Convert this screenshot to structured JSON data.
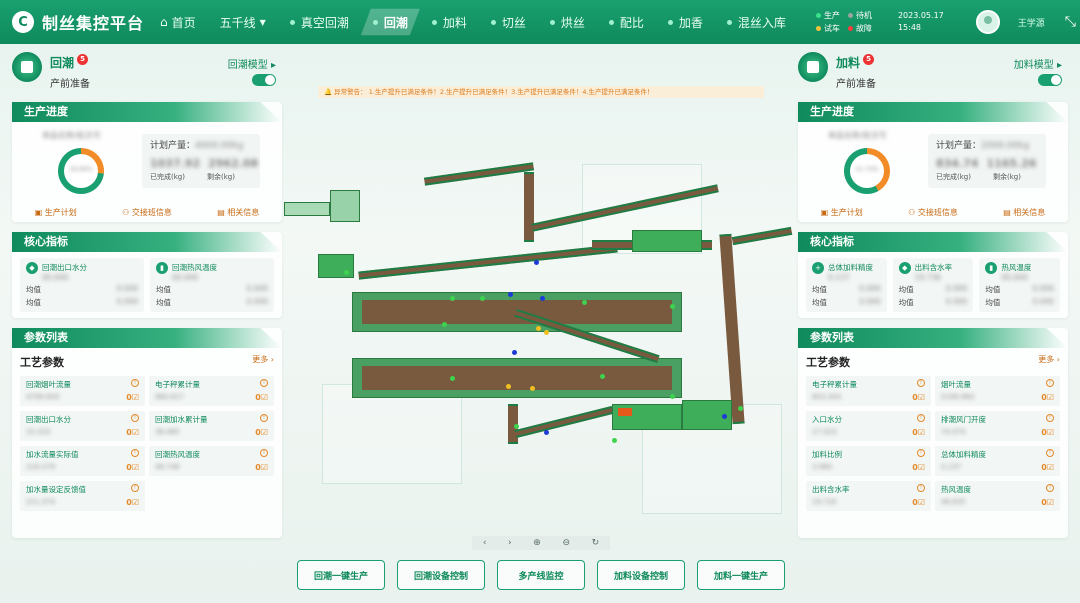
{
  "header": {
    "app_title": "制丝集控平台",
    "logo": "C",
    "nav": {
      "home": "首页",
      "line": "五千线",
      "tabs": [
        "真空回潮",
        "回潮",
        "加料",
        "切丝",
        "烘丝",
        "配比",
        "加香",
        "混丝入库"
      ],
      "active_tab": "回潮"
    },
    "legend": [
      {
        "label": "生产",
        "color": "#38e08a"
      },
      {
        "label": "待机",
        "color": "#9aa3a0"
      },
      {
        "label": "试车",
        "color": "#f6c23e"
      },
      {
        "label": "故障",
        "color": "#ff3b3b"
      }
    ],
    "date": "2023.05.17",
    "time": "15:48",
    "user": "王学源"
  },
  "left": {
    "process": {
      "name": "回潮",
      "badge": "5",
      "state": "产前准备",
      "model_link": "回潮模型 ▸"
    },
    "progress": {
      "title": "生产进度",
      "batch": "单品名称/批次号",
      "percent_text": "26.84%",
      "percent_value": 0.2684,
      "plan_label": "计划产量：",
      "plan_value": "4000.00kg",
      "done_value": "1037.92",
      "remain_value": "2962.08",
      "done_label": "已完成(kg)",
      "remain_label": "剩余(kg)",
      "links": [
        "生产计划",
        "交接班信息",
        "相关信息"
      ]
    },
    "kpi": {
      "title": "核心指标",
      "items": [
        {
          "name": "回潮出口水分",
          "value": "00.000"
        },
        {
          "name": "回潮热风温度",
          "value": "00.000"
        }
      ],
      "rows": [
        [
          "均值",
          "0.000",
          "0.000"
        ],
        [
          "均值",
          "0.000",
          "0.000"
        ]
      ]
    },
    "params": {
      "title": "参数列表",
      "sub_title": "工艺参数",
      "more": "更多 ›",
      "items": [
        {
          "label": "回潮烟叶流量",
          "value": "4799.600"
        },
        {
          "label": "电子秤累计量",
          "value": "960.617"
        },
        {
          "label": "回潮出口水分",
          "value": "15.253"
        },
        {
          "label": "回潮加水累计量",
          "value": "38.485"
        },
        {
          "label": "加水流量实际值",
          "value": "218.279"
        },
        {
          "label": "回潮热风温度",
          "value": "48.748"
        },
        {
          "label": "加水量设定反馈值",
          "value": "211.374"
        }
      ],
      "edit_mark": "0☑"
    }
  },
  "right": {
    "process": {
      "name": "加料",
      "badge": "5",
      "state": "产前准备",
      "model_link": "加料模型 ▸"
    },
    "progress": {
      "title": "生产进度",
      "batch": "单品名称/批次号",
      "percent_text": "41.74%",
      "percent_value": 0.4174,
      "plan_label": "计划产量：",
      "plan_value": "2000.00kg",
      "done_value": "834.74",
      "remain_value": "1165.26",
      "done_label": "已完成(kg)",
      "remain_label": "剩余(kg)",
      "links": [
        "生产计划",
        "交接班信息",
        "相关信息"
      ]
    },
    "kpi": {
      "title": "核心指标",
      "items": [
        {
          "name": "总体加料精度",
          "value": "0.137"
        },
        {
          "name": "出料含水率",
          "value": "19.736"
        },
        {
          "name": "热风温度",
          "value": "00.000"
        }
      ],
      "rows": [
        [
          "均值",
          "0.000",
          "0.000",
          "0.000"
        ],
        [
          "均值",
          "0.000",
          "0.000",
          "0.000"
        ]
      ]
    },
    "params": {
      "title": "参数列表",
      "sub_title": "工艺参数",
      "more": "更多 ›",
      "items": [
        {
          "label": "电子秤累计量",
          "value": "803.344"
        },
        {
          "label": "烟叶流量",
          "value": "5199.960"
        },
        {
          "label": "入口水分",
          "value": "17.023"
        },
        {
          "label": "排潮风门开度",
          "value": "74.474"
        },
        {
          "label": "加料比例",
          "value": "3.980"
        },
        {
          "label": "总体加料精度",
          "value": "0.137"
        },
        {
          "label": "出料含水率",
          "value": "19.720"
        },
        {
          "label": "热风温度",
          "value": "48.635"
        }
      ],
      "edit_mark": "0☑"
    }
  },
  "center": {
    "warning": "🔔 异常警告：    1.生产提升已满足条件！2.生产提升已满足条件！3.生产提升已满足条件！4.生产提升已满足条件！",
    "viewer_controls": [
      "‹",
      "›",
      "⊕",
      "⊖",
      "↻"
    ],
    "bottom_buttons": [
      "回潮一键生产",
      "回潮设备控制",
      "多产线监控",
      "加料设备控制",
      "加料一键生产"
    ]
  }
}
